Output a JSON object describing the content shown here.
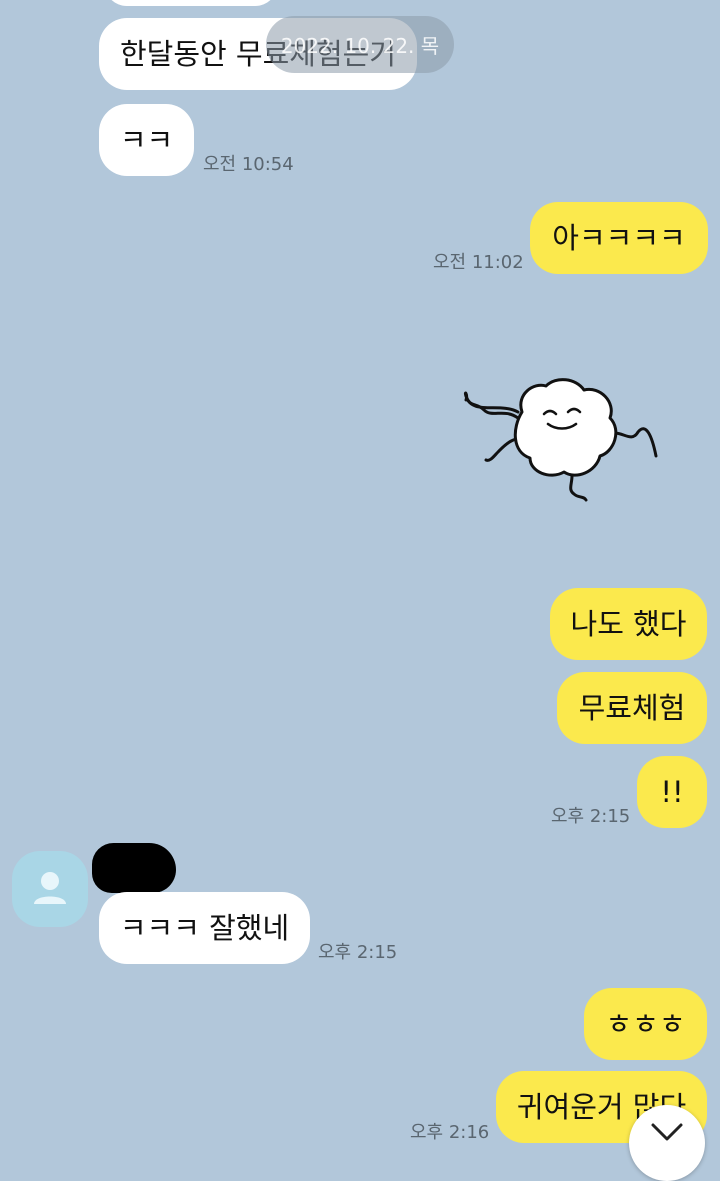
{
  "chat": {
    "date_separator": "2022. 10. 22. 목",
    "messages": [
      {
        "id": "m1",
        "text": "한달동안 무료체험는거"
      },
      {
        "id": "m2",
        "text": "ㅋㅋ",
        "time": "오전 10:54"
      },
      {
        "id": "m3",
        "text": "아ㅋㅋㅋㅋ",
        "time": "오전 11:02"
      },
      {
        "id": "m5",
        "text": "나도 했다"
      },
      {
        "id": "m6",
        "text": "무료체험"
      },
      {
        "id": "m7",
        "text": "!!",
        "time": "오후 2:15"
      },
      {
        "id": "m8",
        "text": "ㅋㅋㅋ 잘했네",
        "time": "오후 2:15"
      },
      {
        "id": "m9",
        "text": "ㅎㅎㅎ"
      },
      {
        "id": "m10",
        "text": "귀여운거 많다",
        "time": "오후 2:16"
      }
    ],
    "sticker": {
      "icon": "cloud-blob-character-sticker"
    },
    "avatar_icon": "default-person-icon",
    "scroll_icon": "chevron-down-icon"
  },
  "colors": {
    "background": "#b2c7da",
    "incoming_bubble": "#ffffff",
    "outgoing_bubble": "#fbe94d",
    "timestamp": "#5a6670",
    "avatar": "#a9d6e6"
  }
}
